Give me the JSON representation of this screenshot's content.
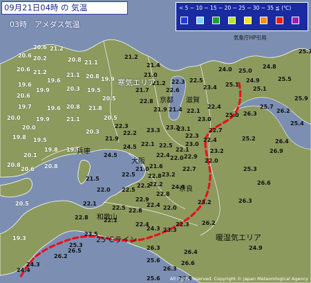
{
  "header": {
    "title": "09月21日04時 の 気温",
    "subtitle": "03時　アメダス気温"
  },
  "legend": {
    "scale_text": "< 5 ~ 10 ~ 15 ~ 20 ~ 25 ~ 30 ~ 35 ≦ (℃)",
    "colors": [
      "#1b3be8",
      "#7fd0ff",
      "#17a32c",
      "#b7e630",
      "#f6e51d",
      "#f39219",
      "#f21a1a",
      "#a21abf"
    ],
    "source_credit": "気象庁HP引用"
  },
  "colors": {
    "sea": "#7c8fb3",
    "land": "#8c9a5e",
    "land_shade": "#6f7e48",
    "boundary_line": "#ffffff",
    "line_25c": "#e8101a",
    "warm_temp_text": "#111111",
    "cold_temp_text": "#ffffff"
  },
  "labels": {
    "cold_area": "寒気エリア",
    "warm_area": "暖湿気エリア",
    "line_25c": "25℃ライン"
  },
  "prefectures": [
    "兵庫",
    "京都",
    "滋賀",
    "大阪",
    "奈良",
    "和歌山"
  ],
  "readings": {
    "cold": [
      "20.6",
      "21.2",
      "20.6",
      "20.2",
      "20.8",
      "21.1",
      "20.6",
      "21.2",
      "19.6",
      "21.1",
      "20.8",
      "19.6",
      "19.9",
      "19.9",
      "19.5",
      "20.6",
      "20.3",
      "20.5",
      "19.6",
      "19.7",
      "20.0",
      "20.8",
      "21.8",
      "19.9",
      "20.0",
      "21.1",
      "20.5",
      "19.8",
      "20.3",
      "19.5",
      "20.1",
      "19.8",
      "20.8",
      "19.9",
      "20.6",
      "20.8",
      "20.5",
      "19.3"
    ],
    "warm": [
      "25.3",
      "25.0",
      "24.9",
      "24.0",
      "24.8",
      "25.1",
      "25.1",
      "25.5",
      "25.9",
      "25.7",
      "26.2",
      "26.3",
      "25.0",
      "25.4",
      "26.4",
      "26.9",
      "25.2",
      "25.3",
      "26.6",
      "26.3",
      "26.2",
      "26.3",
      "26.4",
      "26.6",
      "24.4",
      "24.3",
      "26.2",
      "26.5",
      "25.3",
      "25.6",
      "26.3",
      "25.6",
      "26.6",
      "24.9"
    ],
    "mid": [
      "21.2",
      "21.4",
      "21.0",
      "21.2",
      "22.5",
      "22.6",
      "21.7",
      "22.3",
      "23.4",
      "22.8",
      "21.9",
      "21.4",
      "22.1",
      "22.4",
      "23.0",
      "23.2",
      "23.1",
      "23.3",
      "22.2",
      "22.7",
      "22.4",
      "22.3",
      "23.2",
      "22.0",
      "23.0",
      "22.1",
      "22.5",
      "22.1",
      "22.4",
      "22.0",
      "22.9",
      "21.6",
      "21.0",
      "22.5",
      "22.7",
      "22.8",
      "23.2",
      "22.2",
      "22.2",
      "22.8",
      "22.4",
      "24.5",
      "24.5",
      "21.9",
      "22.3",
      "24.4",
      "22.5",
      "22.9",
      "22.0",
      "22.5",
      "22.8",
      "23.2",
      "23.3",
      "23.5",
      "21.5",
      "22.0",
      "22.1",
      "22.8",
      "22.1",
      "22.4",
      "24.3",
      "22.3"
    ]
  },
  "copyright": "All rights reserved. Copyright © Japan Meteorological Agency"
}
